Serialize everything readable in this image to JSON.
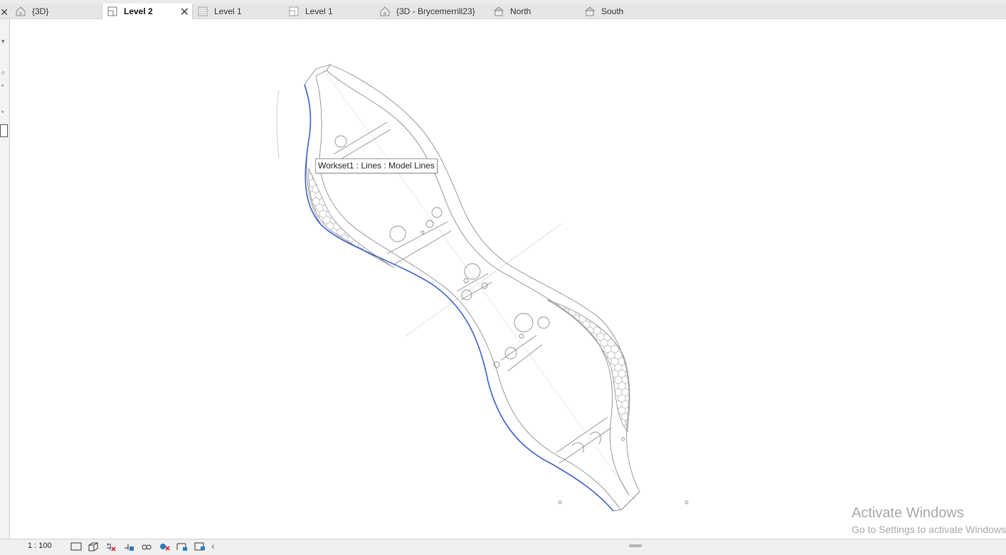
{
  "tabs": [
    {
      "label": "{3D}",
      "icon": "house-3d-icon"
    },
    {
      "label": "Level 2",
      "icon": "floor-plan-icon",
      "active": true,
      "close": "✕"
    },
    {
      "label": "Level 1",
      "icon": "ceiling-plan-icon"
    },
    {
      "label": "Level 1",
      "icon": "floor-plan-icon"
    },
    {
      "label": "{3D - Brycemerrill23}",
      "icon": "house-3d-icon"
    },
    {
      "label": "North",
      "icon": "elevation-icon"
    },
    {
      "label": "South",
      "icon": "elevation-icon"
    }
  ],
  "left_close": "✕",
  "canvas": {
    "tooltip": "Workset1 : Lines : Model Lines",
    "line_color": "#8c8c8c",
    "highlight_color": "#3a5fc8"
  },
  "watermark": {
    "line1": "Activate Windows",
    "line2": "Go to Settings to activate Windows."
  },
  "status": {
    "scale": "1 : 100",
    "icons": [
      "detail-level-icon",
      "visual-style-icon",
      "sun-path-off-icon",
      "shadows-icon",
      "crop-view-icon",
      "temporary-hide-icon",
      "reveal-hidden-icon",
      "show-crop-icon",
      "analytical-model-icon"
    ],
    "scroll_left": "‹"
  }
}
